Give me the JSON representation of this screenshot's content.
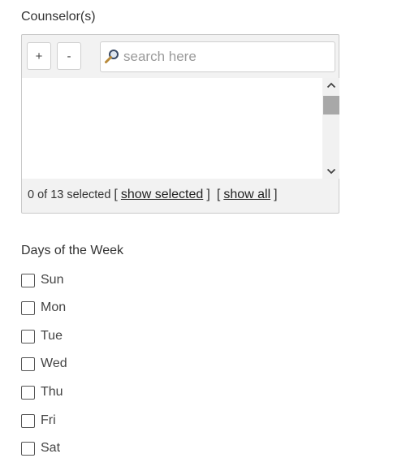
{
  "counselors": {
    "label": "Counselor(s)",
    "add_label": "+",
    "remove_label": "-",
    "search_placeholder": "search here",
    "search_value": "",
    "selected_count_text": "0 of 13 selected",
    "open_bracket": "[",
    "close_bracket": "]",
    "show_selected_label": "show selected",
    "show_all_label": "show all",
    "icons": {
      "search": "magnifier-icon",
      "scroll_up": "chevron-up-icon",
      "scroll_down": "chevron-down-icon"
    }
  },
  "days": {
    "label": "Days of the Week",
    "items": [
      {
        "label": "Sun",
        "checked": false
      },
      {
        "label": "Mon",
        "checked": false
      },
      {
        "label": "Tue",
        "checked": false
      },
      {
        "label": "Wed",
        "checked": false
      },
      {
        "label": "Thu",
        "checked": false
      },
      {
        "label": "Fri",
        "checked": false
      },
      {
        "label": "Sat",
        "checked": false
      }
    ]
  },
  "colors": {
    "panel_bg": "#f2f2f2",
    "border": "#c9c9c9",
    "scroll_thumb": "#a8a8a8",
    "text": "#333333"
  }
}
